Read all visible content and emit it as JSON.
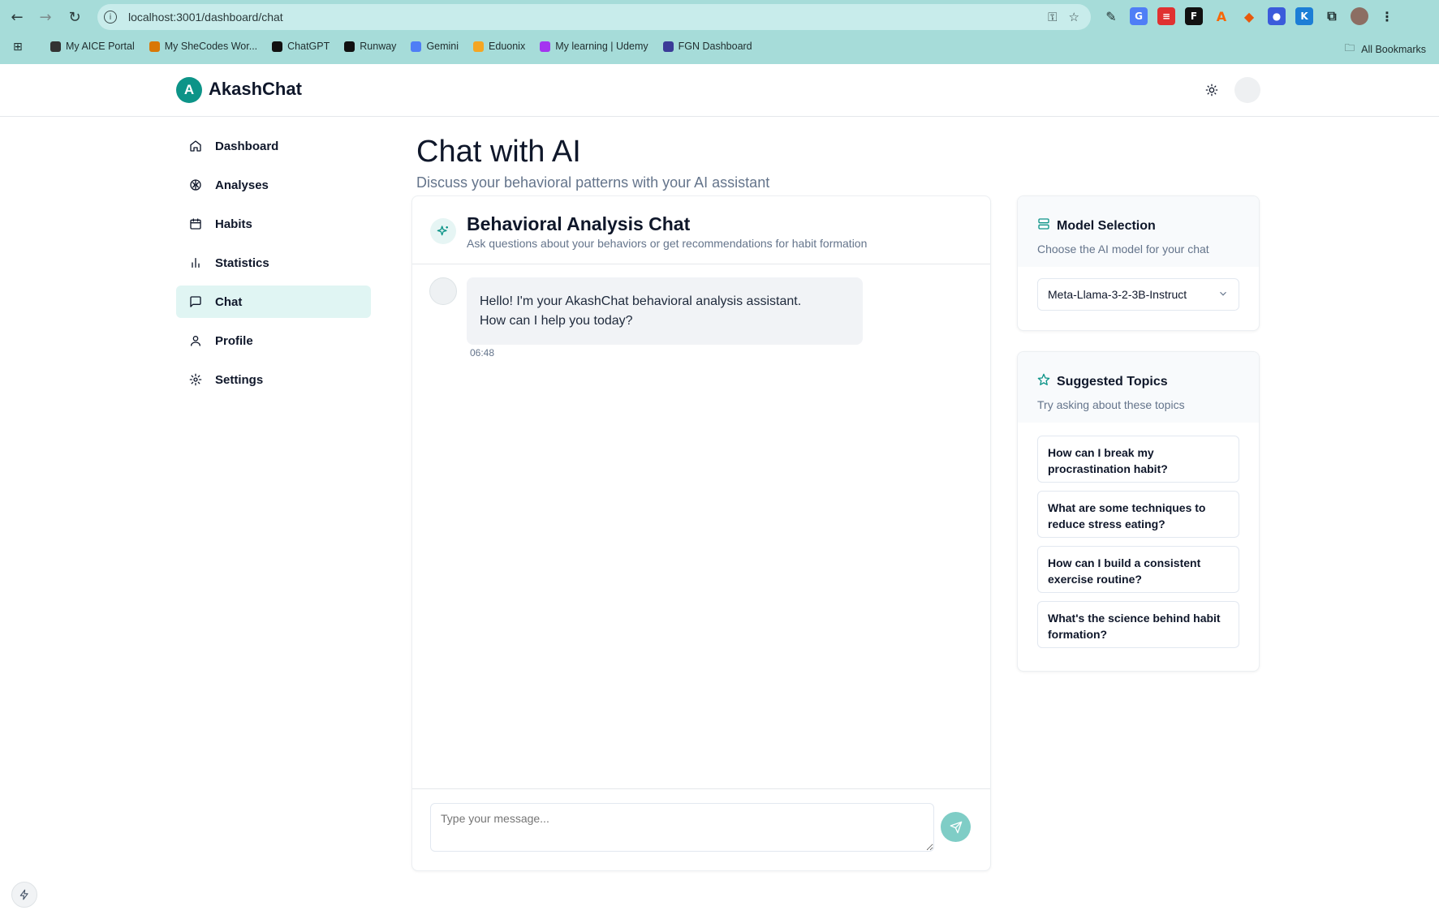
{
  "browser": {
    "url": "localhost:3001/dashboard/chat",
    "bookmarks": [
      {
        "label": "My AICE Portal",
        "color": "#333333"
      },
      {
        "label": "My SheCodes Wor...",
        "color": "#d97706"
      },
      {
        "label": "ChatGPT",
        "color": "#111111"
      },
      {
        "label": "Runway",
        "color": "#111111"
      },
      {
        "label": "Gemini",
        "color": "#4f7ef6"
      },
      {
        "label": "Eduonix",
        "color": "#f5a623"
      },
      {
        "label": "My learning | Udemy",
        "color": "#a435f0"
      },
      {
        "label": "FGN Dashboard",
        "color": "#3b3b98"
      }
    ],
    "all_bookmarks": "All Bookmarks"
  },
  "app": {
    "logo_letter": "A",
    "name": "AkashChat",
    "accent": "#0d9488"
  },
  "sidebar": {
    "items": [
      {
        "label": "Dashboard",
        "icon": "home-icon"
      },
      {
        "label": "Analyses",
        "icon": "brain-icon"
      },
      {
        "label": "Habits",
        "icon": "calendar-icon"
      },
      {
        "label": "Statistics",
        "icon": "bar-chart-icon"
      },
      {
        "label": "Chat",
        "icon": "message-icon",
        "active": true
      },
      {
        "label": "Profile",
        "icon": "user-icon"
      },
      {
        "label": "Settings",
        "icon": "gear-icon"
      }
    ]
  },
  "page": {
    "title": "Chat with AI",
    "subtitle": "Discuss your behavioral patterns with your AI assistant"
  },
  "chat": {
    "title": "Behavioral Analysis Chat",
    "description": "Ask questions about your behaviors or get recommendations for habit formation",
    "messages": [
      {
        "sender": "assistant",
        "text_line1": "Hello! I'm your AkashChat behavioral analysis assistant.",
        "text_line2": "How can I help you today?",
        "time": "06:48"
      }
    ],
    "input_placeholder": "Type your message..."
  },
  "model_selection": {
    "title": "Model Selection",
    "description": "Choose the AI model for your chat",
    "selected": "Meta-Llama-3-2-3B-Instruct"
  },
  "suggested_topics": {
    "title": "Suggested Topics",
    "description": "Try asking about these topics",
    "topics": [
      "How can I break my procrastination habit?",
      "What are some techniques to reduce stress eating?",
      "How can I build a consistent exercise routine?",
      "What's the science behind habit formation?"
    ]
  }
}
